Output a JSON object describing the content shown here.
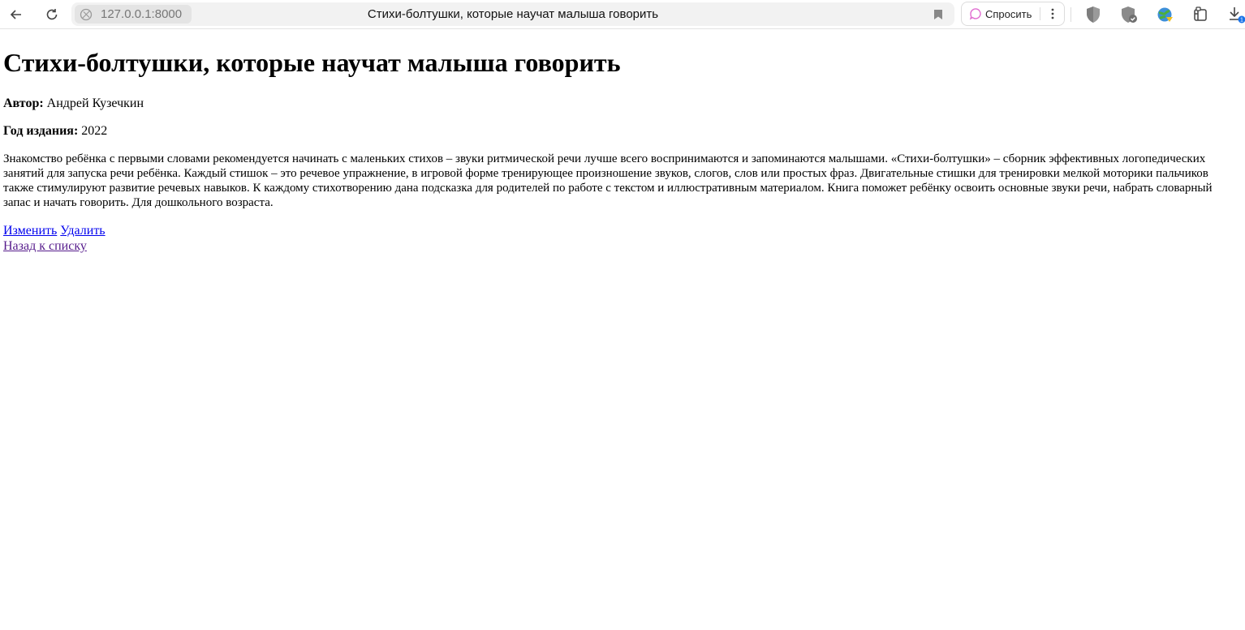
{
  "browser": {
    "url": "127.0.0.1:8000",
    "tab_title": "Стихи-болтушки, которые научат малыша говорить",
    "ask_label": "Спросить",
    "download_badge": "1"
  },
  "book": {
    "title": "Стихи-болтушки, которые научат малыша говорить",
    "author_label": "Автор:",
    "author": "Андрей Кузечкин",
    "year_label": "Год издания:",
    "year": "2022",
    "description": "Знакомство ребёнка с первыми словами рекомендуется начинать с маленьких стихов – звуки ритмической речи лучше всего воспринимаются и запоминаются малышами. «Стихи-болтушки» – сборник эффективных логопедических занятий для запуска речи ребёнка. Каждый стишок – это речевое упражнение, в игровой форме тренирующее произношение звуков, слогов, слов или простых фраз. Двигательные стишки для тренировки мелкой моторики пальчиков также стимулируют развитие речевых навыков. К каждому стихотворению дана подсказка для родителей по работе с текстом и иллюстративным материалом. Книга поможет ребёнку освоить основные звуки речи, набрать словарный запас и начать говорить. Для дошкольного возраста."
  },
  "actions": {
    "edit": "Изменить",
    "delete": "Удалить",
    "back": "Назад к списку"
  }
}
